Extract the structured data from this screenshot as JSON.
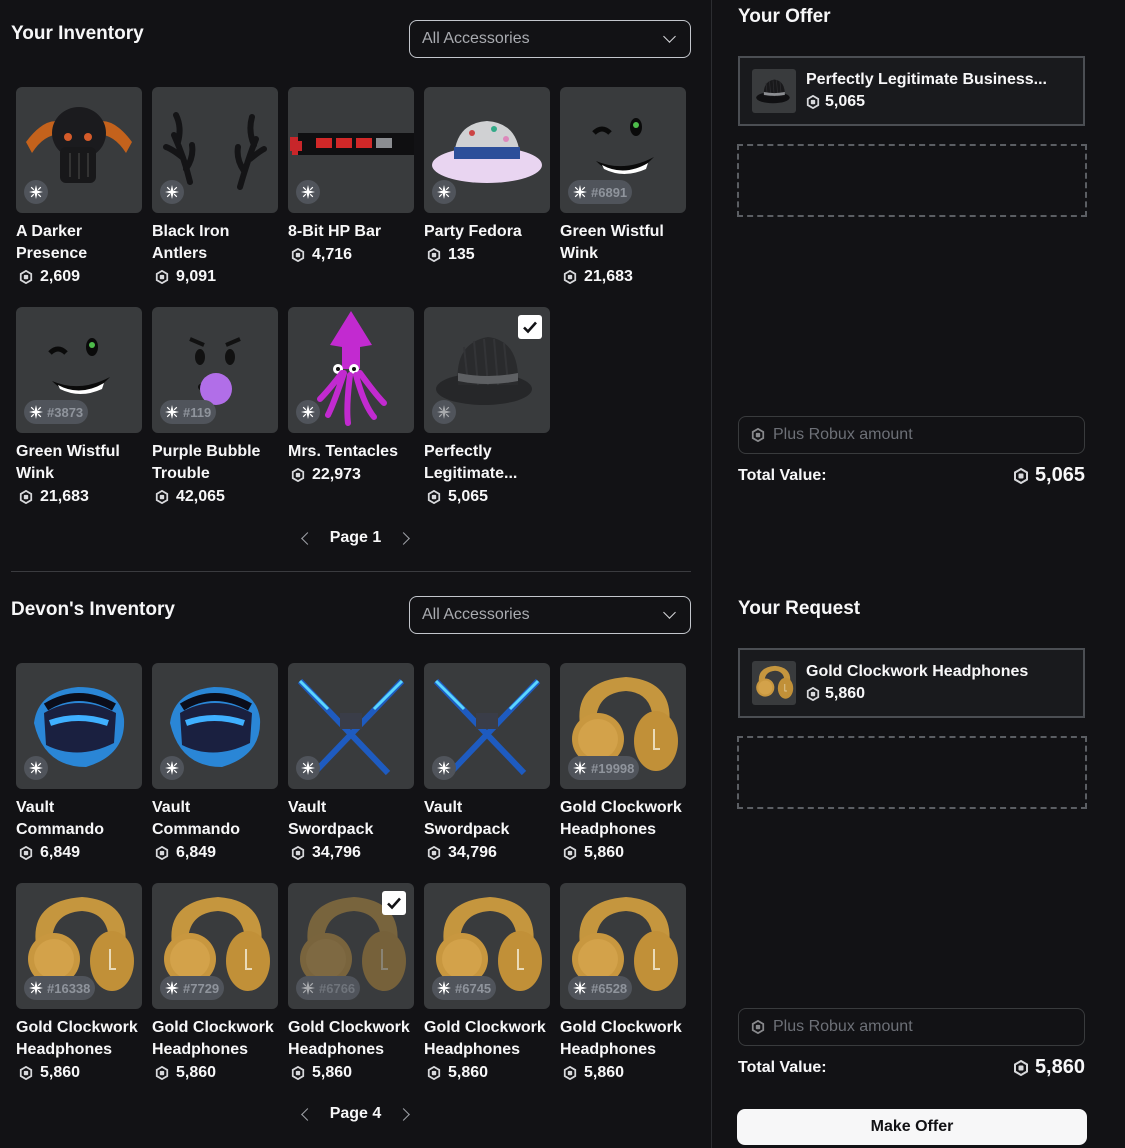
{
  "your_inventory": {
    "title": "Your Inventory",
    "filter": "All Accessories",
    "page_label": "Page 1",
    "items": [
      {
        "name": "A Darker Presence",
        "price": "2,609",
        "serial": "",
        "selected": false,
        "art": "hood"
      },
      {
        "name": "Black Iron Antlers",
        "price": "9,091",
        "serial": "",
        "selected": false,
        "art": "antlers"
      },
      {
        "name": "8-Bit HP Bar",
        "price": "4,716",
        "serial": "",
        "selected": false,
        "art": "hpbar"
      },
      {
        "name": "Party Fedora",
        "price": "135",
        "serial": "",
        "selected": false,
        "art": "partyfedora"
      },
      {
        "name": "Green Wistful Wink",
        "price": "21,683",
        "serial": "#6891",
        "selected": false,
        "art": "wink"
      },
      {
        "name": "Green Wistful Wink",
        "price": "21,683",
        "serial": "#3873",
        "selected": false,
        "art": "wink"
      },
      {
        "name": "Purple Bubble Trouble",
        "price": "42,065",
        "serial": "#119",
        "selected": false,
        "art": "bubble"
      },
      {
        "name": "Mrs. Tentacles",
        "price": "22,973",
        "serial": "",
        "selected": false,
        "art": "squid"
      },
      {
        "name": "Perfectly Legitimate...",
        "price": "5,065",
        "serial": "",
        "selected": true,
        "art": "fedora"
      }
    ]
  },
  "devon_inventory": {
    "title": "Devon's Inventory",
    "filter": "All Accessories",
    "page_label": "Page 4",
    "items": [
      {
        "name": "Vault Commando",
        "price": "6,849",
        "serial": "",
        "selected": false,
        "art": "vault"
      },
      {
        "name": "Vault Commando",
        "price": "6,849",
        "serial": "",
        "selected": false,
        "art": "vault"
      },
      {
        "name": "Vault Swordpack",
        "price": "34,796",
        "serial": "",
        "selected": false,
        "art": "swords"
      },
      {
        "name": "Vault Swordpack",
        "price": "34,796",
        "serial": "",
        "selected": false,
        "art": "swords"
      },
      {
        "name": "Gold Clockwork Headphones",
        "price": "5,860",
        "serial": "#19998",
        "selected": false,
        "art": "headphones"
      },
      {
        "name": "Gold Clockwork Headphones",
        "price": "5,860",
        "serial": "#16338",
        "selected": false,
        "art": "headphones"
      },
      {
        "name": "Gold Clockwork Headphones",
        "price": "5,860",
        "serial": "#7729",
        "selected": false,
        "art": "headphones"
      },
      {
        "name": "Gold Clockwork Headphones",
        "price": "5,860",
        "serial": "#6766",
        "selected": true,
        "art": "headphones"
      },
      {
        "name": "Gold Clockwork Headphones",
        "price": "5,860",
        "serial": "#6745",
        "selected": false,
        "art": "headphones"
      },
      {
        "name": "Gold Clockwork Headphones",
        "price": "5,860",
        "serial": "#6528",
        "selected": false,
        "art": "headphones"
      }
    ]
  },
  "offer": {
    "title": "Your Offer",
    "item_name": "Perfectly Legitimate Business...",
    "item_price": "5,065",
    "robux_placeholder": "Plus Robux amount",
    "total_label": "Total Value:",
    "total_value": "5,065"
  },
  "request": {
    "title": "Your Request",
    "item_name": "Gold Clockwork Headphones",
    "item_price": "5,860",
    "robux_placeholder": "Plus Robux amount",
    "total_label": "Total Value:",
    "total_value": "5,860"
  },
  "make_offer_label": "Make Offer",
  "icons": {
    "robux": "robux-icon",
    "limited": "sparkle-icon",
    "check": "checkmark-icon"
  }
}
